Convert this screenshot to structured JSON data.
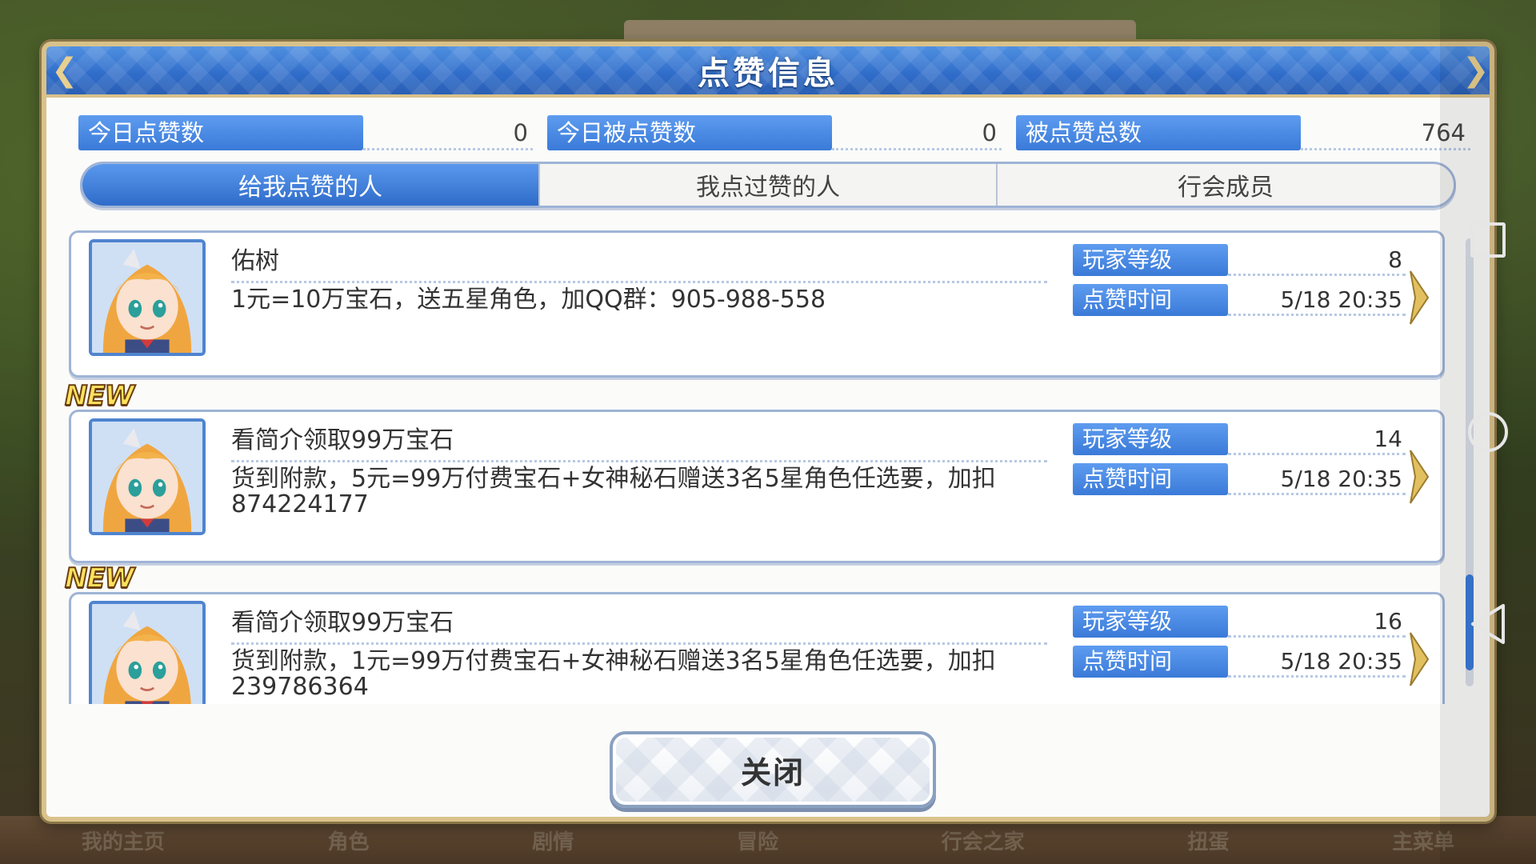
{
  "dialog": {
    "title": "点赞信息",
    "close_label": "关闭"
  },
  "stats": [
    {
      "label": "今日点赞数",
      "value": "0"
    },
    {
      "label": "今日被点赞数",
      "value": "0"
    },
    {
      "label": "被点赞总数",
      "value": "764"
    }
  ],
  "tabs": [
    {
      "label": "给我点赞的人",
      "active": true
    },
    {
      "label": "我点过赞的人",
      "active": false
    },
    {
      "label": "行会成员",
      "active": false
    }
  ],
  "list": {
    "level_label": "玩家等级",
    "time_label": "点赞时间",
    "new_badge": "NEW",
    "items": [
      {
        "name": "佑树",
        "desc": "1元=10万宝石，送五星角色，加QQ群：905-988-558",
        "level": "8",
        "time": "5/18 20:35"
      },
      {
        "name": "看简介领取99万宝石",
        "desc": "货到附款，5元=99万付费宝石+女神秘石赠送3名5星角色任选要，加扣874224177",
        "level": "14",
        "time": "5/18 20:35"
      },
      {
        "name": "看简介领取99万宝石",
        "desc": "货到附款，1元=99万付费宝石+女神秘石赠送3名5星角色任选要，加扣239786364",
        "level": "16",
        "time": "5/18 20:35"
      }
    ]
  },
  "background": {
    "bottom_menu": [
      "我的主页",
      "角色",
      "剧情",
      "冒险",
      "行会之家",
      "扭蛋",
      "主菜单"
    ]
  },
  "colors": {
    "accent_blue": "#3a7ad8",
    "gold_border": "#d9c28a",
    "new_badge": "#ffe25c"
  }
}
